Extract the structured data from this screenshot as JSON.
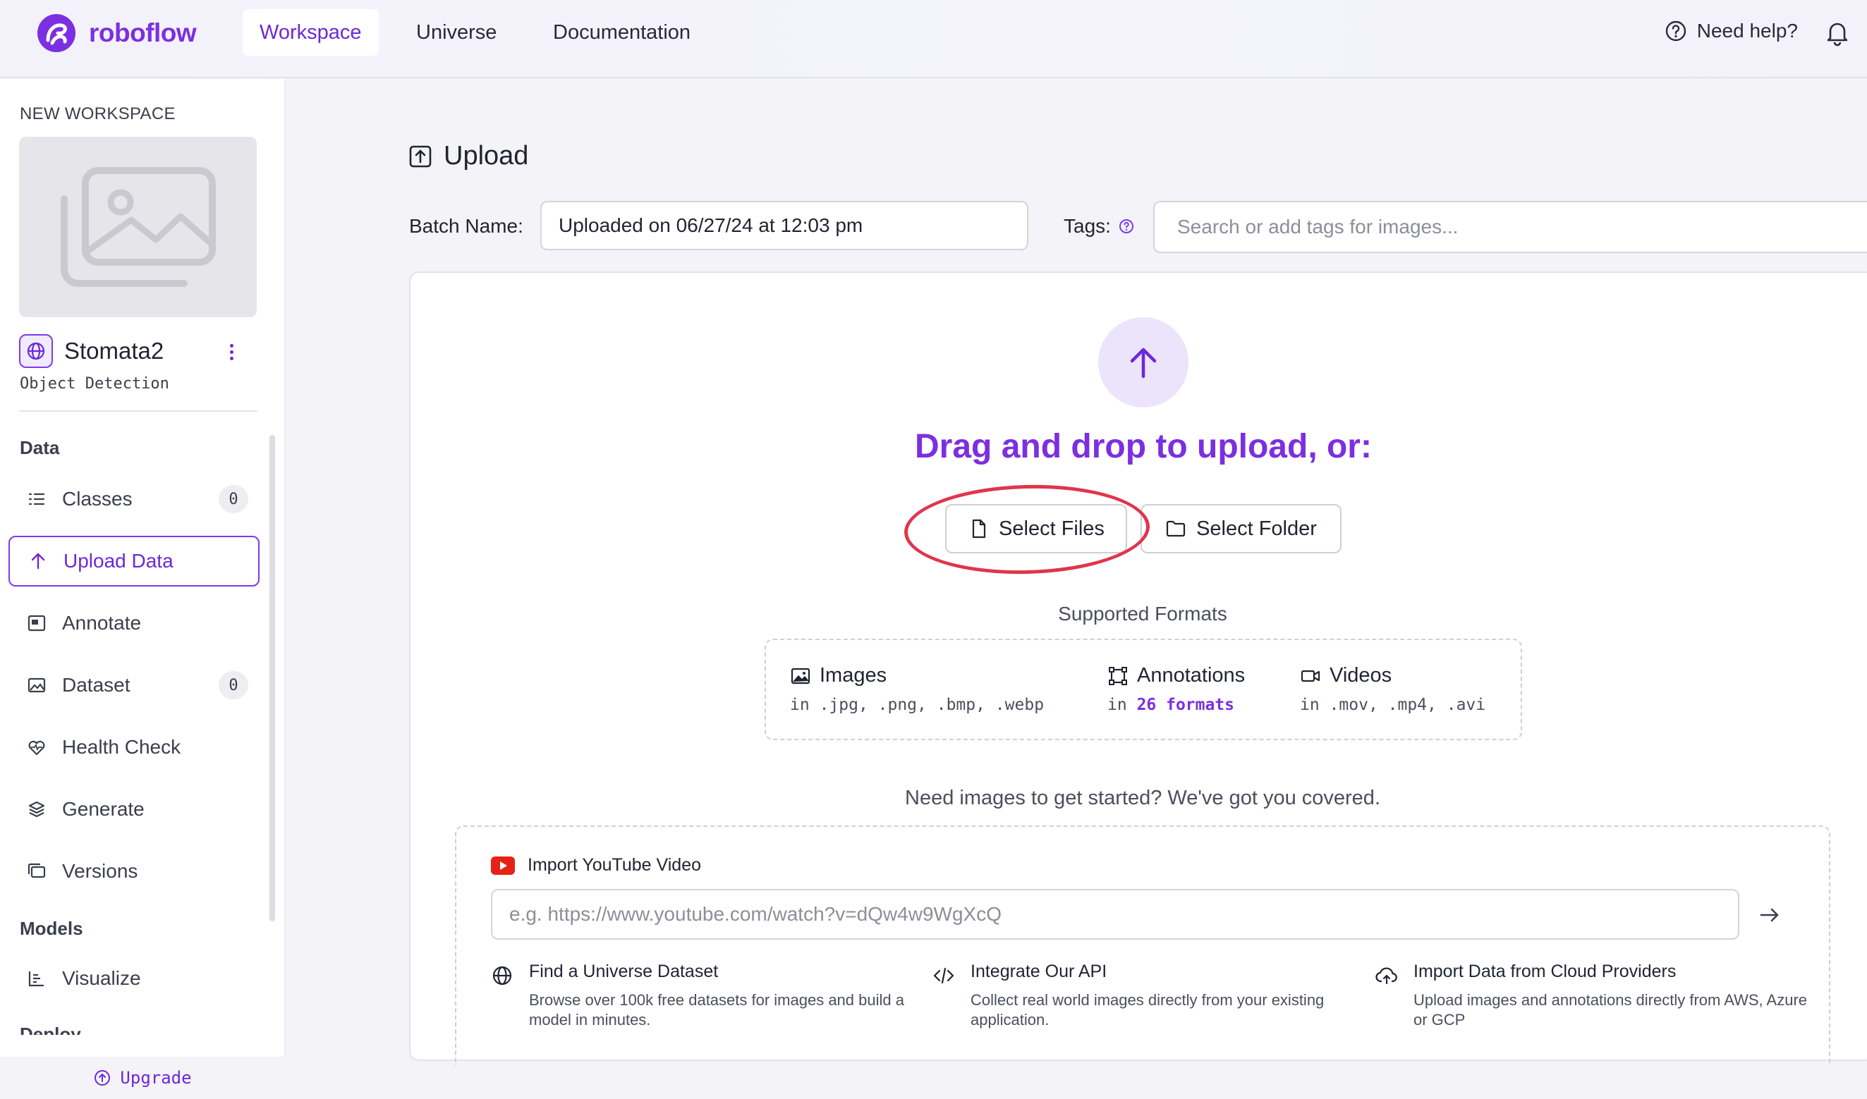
{
  "nav": {
    "brand": "roboflow",
    "tabs": [
      {
        "label": "Workspace",
        "active": true
      },
      {
        "label": "Universe",
        "active": false
      },
      {
        "label": "Documentation",
        "active": false
      }
    ],
    "help_label": "Need help?",
    "accent_color": "#7c2fe0"
  },
  "sidebar": {
    "workspace_label": "NEW WORKSPACE",
    "project_name": "Stomata2",
    "project_type": "Object Detection",
    "sections": {
      "data": "Data",
      "models": "Models",
      "deploy": "Deploy"
    },
    "items": [
      {
        "label": "Classes",
        "icon": "list-icon",
        "count": "0"
      },
      {
        "label": "Upload Data",
        "icon": "upload-arrow-icon",
        "active": true
      },
      {
        "label": "Annotate",
        "icon": "annotate-icon"
      },
      {
        "label": "Dataset",
        "icon": "images-icon",
        "count": "0"
      },
      {
        "label": "Health Check",
        "icon": "heart-pulse-icon"
      },
      {
        "label": "Generate",
        "icon": "layers-icon"
      },
      {
        "label": "Versions",
        "icon": "versions-icon"
      },
      {
        "label": "Visualize",
        "icon": "chart-icon"
      }
    ],
    "upgrade_label": "Upgrade"
  },
  "main": {
    "title": "Upload",
    "batch_label": "Batch Name:",
    "batch_value": "Uploaded on 06/27/24 at 12:03 pm",
    "tags_label": "Tags:",
    "tags_placeholder": "Search or add tags for images...",
    "drop_title": "Drag and drop to upload, or:",
    "select_files": "Select Files",
    "select_folder": "Select Folder",
    "supported_label": "Supported Formats",
    "formats": [
      {
        "name": "Images",
        "prefix": "in",
        "detail": ".jpg, .png, .bmp, .webp"
      },
      {
        "name": "Annotations",
        "prefix": "in",
        "detail": "26 formats"
      },
      {
        "name": "Videos",
        "prefix": "in",
        "detail": ".mov, .mp4, .avi"
      }
    ],
    "need_images": "Need images to get started? We've got you covered.",
    "youtube": {
      "title": "Import YouTube Video",
      "placeholder": "e.g. https://www.youtube.com/watch?v=dQw4w9WgXcQ"
    },
    "options": [
      {
        "title": "Find a Universe Dataset",
        "desc": "Browse over 100k free datasets for images and build a model in minutes."
      },
      {
        "title": "Integrate Our API",
        "desc": "Collect real world images directly from your existing application."
      },
      {
        "title": "Import Data from Cloud Providers",
        "desc": "Upload images and annotations directly from AWS, Azure or GCP"
      }
    ]
  }
}
